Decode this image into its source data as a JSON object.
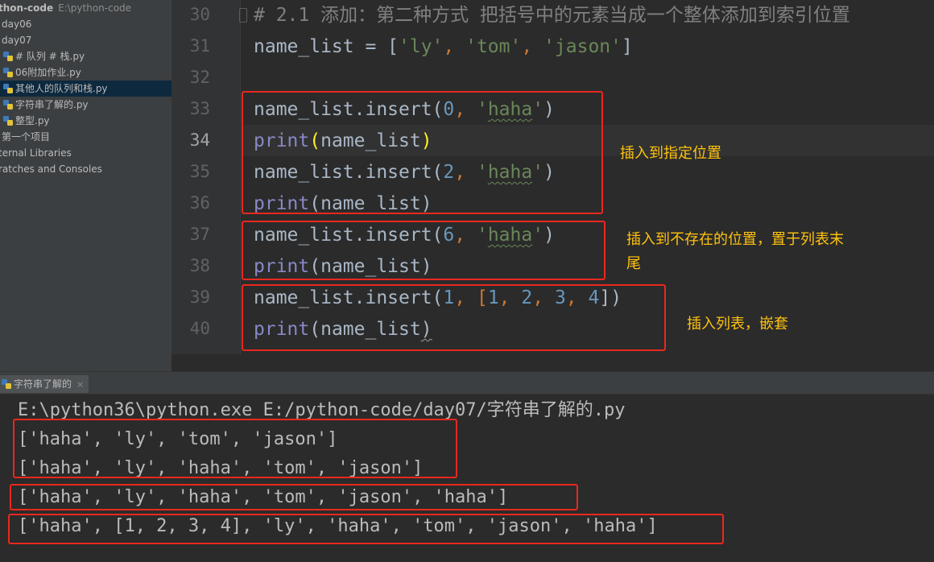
{
  "project": {
    "root_name": "thon-code",
    "root_path": "E:\\python-code",
    "items": [
      {
        "label": "day06",
        "type": "folder"
      },
      {
        "label": "day07",
        "type": "folder"
      },
      {
        "label": "# 队列 # 栈.py",
        "type": "py"
      },
      {
        "label": "06附加作业.py",
        "type": "py"
      },
      {
        "label": "其他人的队列和栈.py",
        "type": "py",
        "selected": true
      },
      {
        "label": "字符串了解的.py",
        "type": "py"
      },
      {
        "label": "整型.py",
        "type": "py"
      },
      {
        "label": "第一个项目",
        "type": "folder"
      },
      {
        "label": "ternal Libraries",
        "type": "lib"
      },
      {
        "label": "ratches and Consoles",
        "type": "lib"
      }
    ]
  },
  "editor": {
    "line_numbers": [
      "30",
      "31",
      "32",
      "33",
      "34",
      "35",
      "36",
      "37",
      "38",
      "39",
      "40"
    ],
    "current_line": "34",
    "code": {
      "l30": "# 2.1 添加：第二种方式 把括号中的元素当成一个整体添加到索引位置",
      "l31": {
        "a": "name_list = [",
        "b": "'ly'",
        "c": ", ",
        "d": "'tom'",
        "e": ", ",
        "f": "'jason'",
        "g": "]"
      },
      "l33": {
        "a": "name_list.insert(",
        "b": "0",
        "c": ", ",
        "d": "'",
        "e": "haha",
        "f": "'",
        "g": ")"
      },
      "l34": {
        "a": "print",
        "b": "(",
        "c": "name_list",
        "d": ")"
      },
      "l35": {
        "a": "name_list.insert(",
        "b": "2",
        "c": ", ",
        "d": "'",
        "e": "haha",
        "f": "'",
        "g": ")"
      },
      "l36": {
        "a": "print",
        "b": "(name_list)"
      },
      "l37": {
        "a": "name_list.insert(",
        "b": "6",
        "c": ", ",
        "d": "'",
        "e": "haha",
        "f": "'",
        "g": ")"
      },
      "l38": {
        "a": "print",
        "b": "(name_list)"
      },
      "l39": {
        "a": "name_list.insert(",
        "b": "1",
        "c": ", [",
        "d": "1",
        "e": ", ",
        "f": "2",
        "g": ", ",
        "h": "3",
        "i": ", ",
        "j": "4",
        "k": "])"
      },
      "l40": {
        "a": "print",
        "b": "(name_list",
        "c": ")"
      }
    }
  },
  "annotations": {
    "a1": "插入到指定位置",
    "a2_line1": "插入到不存在的位置，置于列表末",
    "a2_line2": "尾",
    "a3": "插入列表，嵌套"
  },
  "run": {
    "tab_label": "字符串了解的",
    "tab_close": "×",
    "command": "E:\\python36\\python.exe E:/python-code/day07/字符串了解的.py",
    "outputs": [
      "['haha', 'ly', 'tom', 'jason']",
      "['haha', 'ly', 'haha', 'tom', 'jason']",
      "['haha', 'ly', 'haha', 'tom', 'jason', 'haha']",
      "['haha', [1, 2, 3, 4], 'ly', 'haha', 'tom', 'jason', 'haha']"
    ]
  },
  "colors": {
    "highlight_box": "#e8281f",
    "annotation_text": "#ffc20e",
    "string": "#6a8759",
    "number": "#6897bb",
    "builtin": "#8888c6",
    "comment": "#808080"
  }
}
